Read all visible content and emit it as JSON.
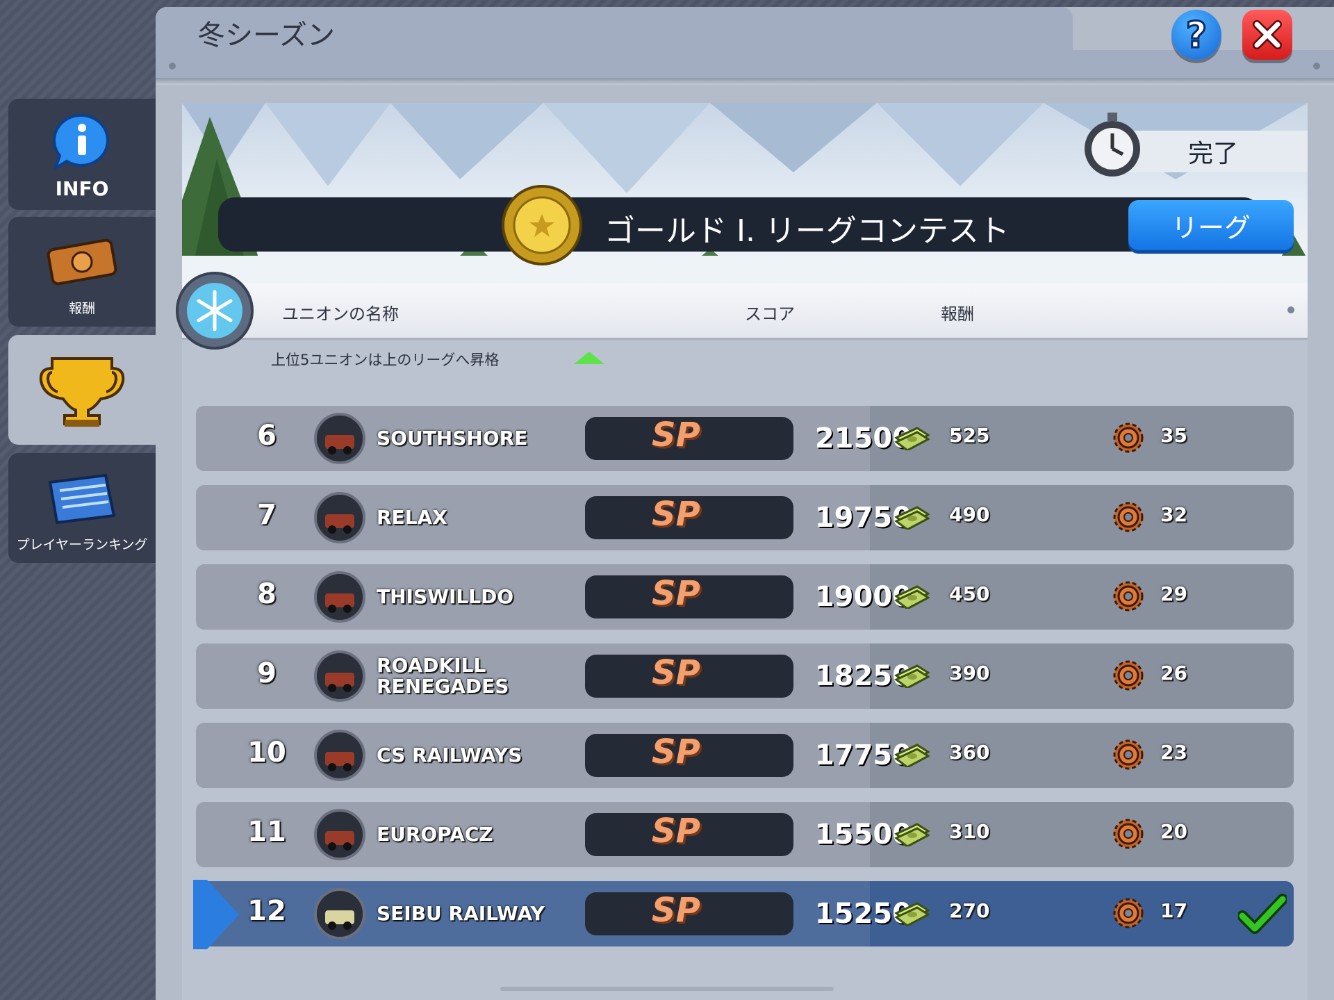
{
  "window": {
    "title": "冬シーズン"
  },
  "controls": {
    "help_icon": "question-icon",
    "close_icon": "close-icon"
  },
  "sidebar": {
    "items": [
      {
        "label": "INFO",
        "icon": "info-icon"
      },
      {
        "label": "報酬",
        "icon": "ticket-icon"
      },
      {
        "label": "",
        "icon": "trophy-icon"
      },
      {
        "label": "プレイヤーランキング",
        "icon": "ranking-board-icon"
      }
    ]
  },
  "banner": {
    "league_name": "ゴールド I. リーグコンテスト",
    "league_button": "リーグ",
    "status": "完了"
  },
  "table": {
    "headers": {
      "name": "ユニオンの名称",
      "score": "スコア",
      "reward": "報酬"
    },
    "promo_note": "上位5ユニオンは上のリーグへ昇格",
    "sp_label": "SP",
    "rows": [
      {
        "rank": "6",
        "name": "SOUTHSHORE",
        "score": "21500",
        "cash": "525",
        "gears": "35",
        "highlight": false
      },
      {
        "rank": "7",
        "name": "RELAX",
        "score": "19750",
        "cash": "490",
        "gears": "32",
        "highlight": false
      },
      {
        "rank": "8",
        "name": "THISWILLDO",
        "score": "19000",
        "cash": "450",
        "gears": "29",
        "highlight": false
      },
      {
        "rank": "9",
        "name": "ROADKILL RENEGADES",
        "score": "18250",
        "cash": "390",
        "gears": "26",
        "highlight": false
      },
      {
        "rank": "10",
        "name": "CS RAILWAYS",
        "score": "17750",
        "cash": "360",
        "gears": "23",
        "highlight": false
      },
      {
        "rank": "11",
        "name": "EUROPACZ",
        "score": "15500",
        "cash": "310",
        "gears": "20",
        "highlight": false
      },
      {
        "rank": "12",
        "name": "SEIBU RAILWAY",
        "score": "15250",
        "cash": "270",
        "gears": "17",
        "highlight": true
      }
    ]
  },
  "colors": {
    "accent_blue": "#1f7fe8",
    "close_red": "#e02a2a",
    "sp_orange": "#f2a070",
    "check_green": "#2fc11f"
  }
}
